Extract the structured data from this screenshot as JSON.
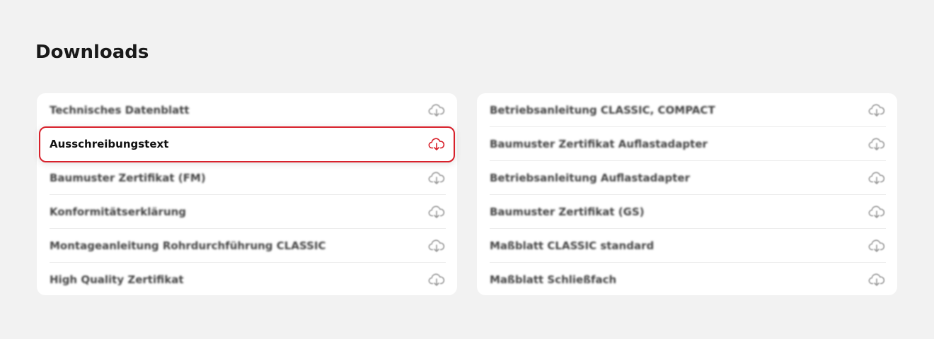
{
  "page": {
    "title": "Downloads"
  },
  "downloads": {
    "left": [
      {
        "label": "Technisches Datenblatt",
        "icon": "cloud-download-icon"
      },
      {
        "label": "Ausschreibungstext",
        "icon": "cloud-download-icon",
        "highlighted": true
      },
      {
        "label": "Baumuster Zertifikat (FM)",
        "icon": "cloud-download-icon"
      },
      {
        "label": "Konformitätserklärung",
        "icon": "cloud-download-icon"
      },
      {
        "label": "Montageanleitung Rohrdurchführung CLASSIC",
        "icon": "cloud-download-icon"
      },
      {
        "label": "High Quality Zertifikat",
        "icon": "cloud-download-icon"
      }
    ],
    "right": [
      {
        "label": "Betriebsanleitung CLASSIC, COMPACT",
        "icon": "cloud-download-icon"
      },
      {
        "label": "Baumuster Zertifikat Auflastadapter",
        "icon": "cloud-download-icon"
      },
      {
        "label": "Betriebsanleitung Auflastadapter",
        "icon": "cloud-download-icon"
      },
      {
        "label": "Baumuster Zertifikat (GS)",
        "icon": "cloud-download-icon"
      },
      {
        "label": "Maßblatt CLASSIC standard",
        "icon": "cloud-download-icon"
      },
      {
        "label": "Maßblatt Schließfach",
        "icon": "cloud-download-icon"
      }
    ]
  },
  "colors": {
    "background": "#f2f2f2",
    "card": "#ffffff",
    "highlight_border": "#d8212b",
    "icon_default": "#9a9a9a",
    "icon_highlight": "#d8212b"
  }
}
